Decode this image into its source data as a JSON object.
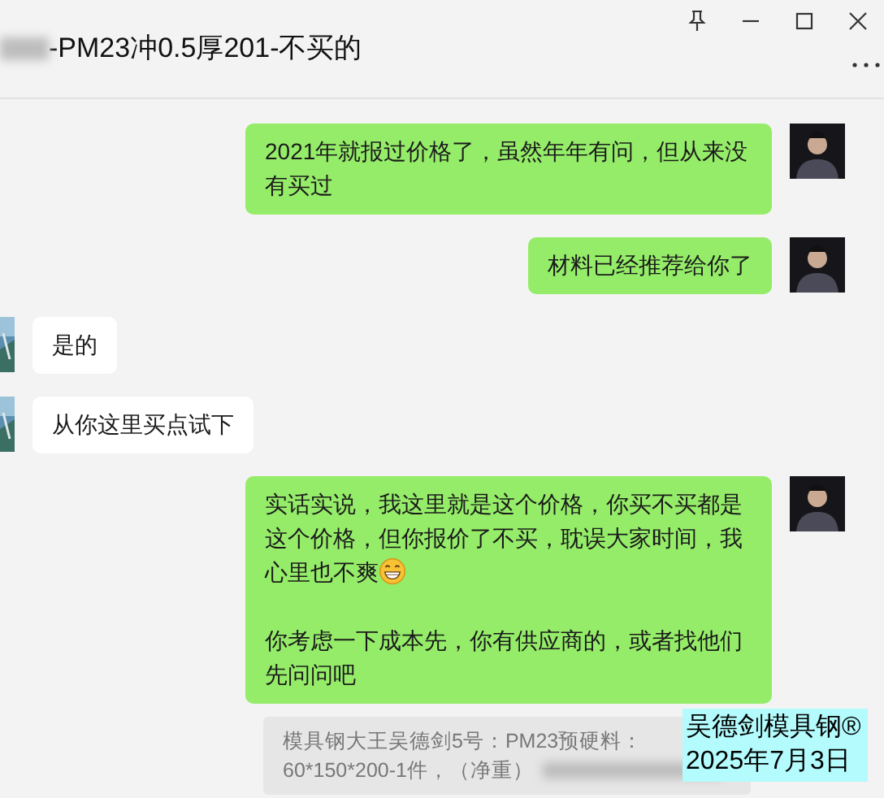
{
  "header": {
    "title": "-PM23冲0.5厚201-不买的",
    "title_redacted_prefix": true
  },
  "window_controls": [
    {
      "kind": "pin"
    },
    {
      "kind": "minimize"
    },
    {
      "kind": "maximize"
    },
    {
      "kind": "close"
    }
  ],
  "messages": [
    {
      "outgoing": true,
      "paragraphs": [
        {
          "text": "2021年就报过价格了，虽然年年有问，但从来没有买过"
        }
      ]
    },
    {
      "outgoing": true,
      "paragraphs": [
        {
          "text": "材料已经推荐给你了"
        }
      ]
    },
    {
      "outgoing": false,
      "paragraphs": [
        {
          "text": "是的"
        }
      ]
    },
    {
      "outgoing": false,
      "paragraphs": [
        {
          "text": "从你这里买点试下"
        }
      ]
    },
    {
      "outgoing": true,
      "paragraphs": [
        {
          "text": "实话实说，我这里就是这个价格，你买不买都是这个价格，但你报价了不买，耽误大家时间，我心里也不爽",
          "trailing_emoji": true
        },
        {
          "text": "你考虑一下成本先，你有供应商的，或者找他们先问问吧"
        }
      ]
    }
  ],
  "quote": {
    "lines": [
      "模具钢大王吴德剑5号：PM23预硬料：",
      "60*150*200-1件，（净重）"
    ],
    "redacted_tail": true
  },
  "overlay": {
    "lines": [
      "吴德剑模具钢®",
      "2025年7月3日"
    ]
  }
}
